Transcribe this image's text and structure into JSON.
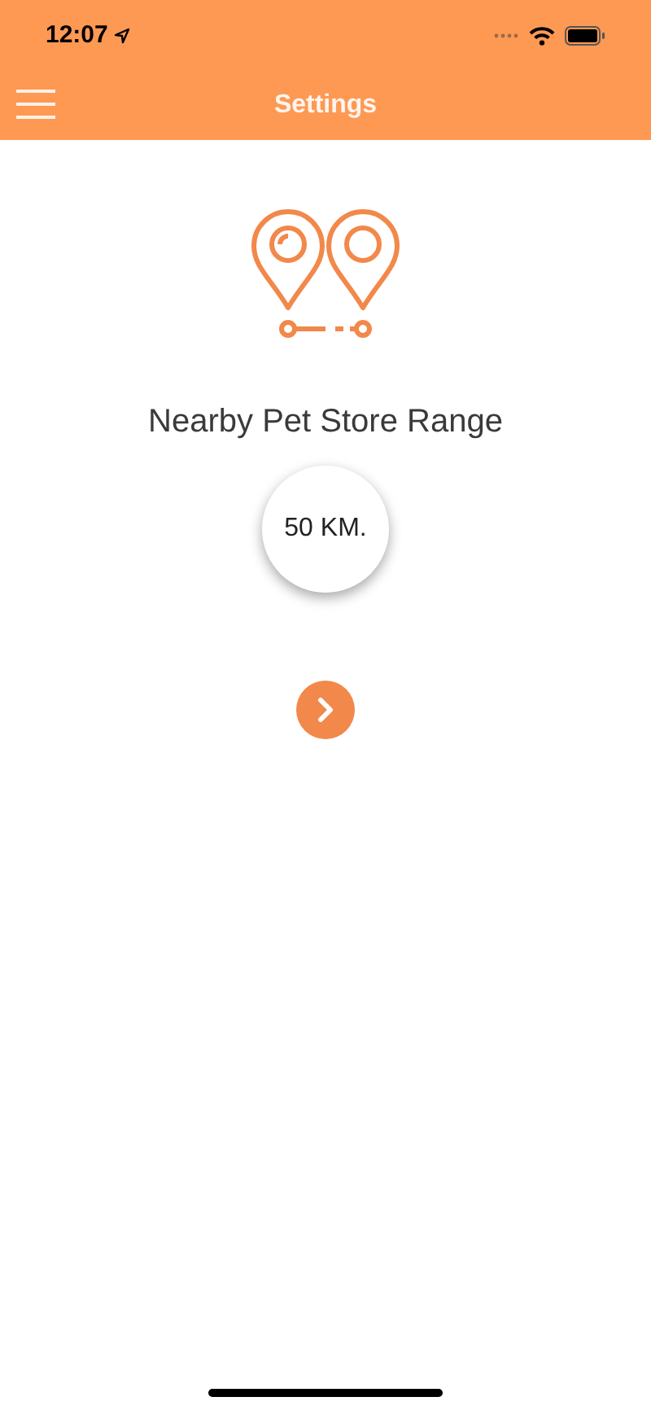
{
  "status_bar": {
    "time": "12:07"
  },
  "nav_bar": {
    "title": "Settings"
  },
  "range": {
    "title": "Nearby Pet Store Range",
    "value": "50 KM."
  }
}
